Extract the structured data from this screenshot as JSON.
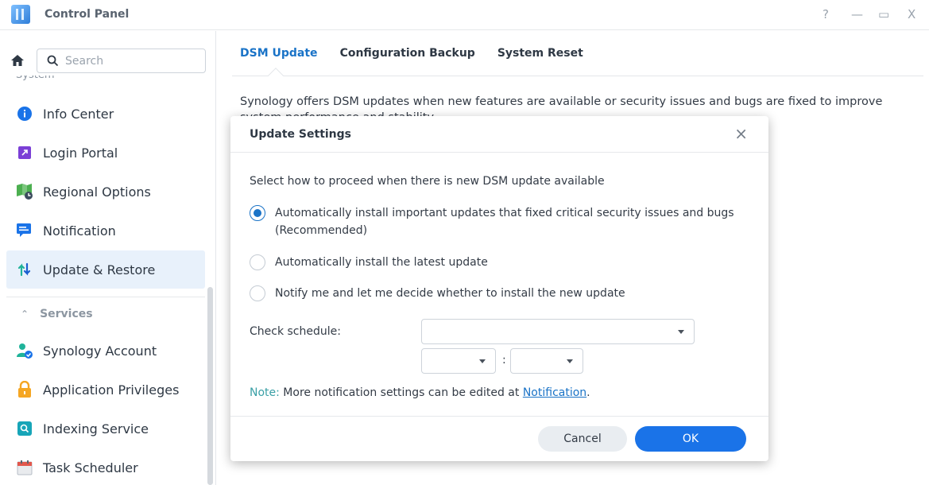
{
  "window": {
    "title": "Control Panel",
    "controls": {
      "help": "?",
      "minimize": "—",
      "maximize": "▭",
      "close": "X"
    }
  },
  "sidebar": {
    "search_placeholder": "Search",
    "cut_section": "System",
    "items": [
      {
        "label": "Info Center",
        "icon": "info-icon"
      },
      {
        "label": "Login Portal",
        "icon": "login-portal-icon"
      },
      {
        "label": "Regional Options",
        "icon": "regional-options-icon"
      },
      {
        "label": "Notification",
        "icon": "notification-icon"
      },
      {
        "label": "Update & Restore",
        "icon": "update-restore-icon",
        "active": true
      }
    ],
    "services_label": "Services",
    "services_items": [
      {
        "label": "Synology Account",
        "icon": "user-account-icon"
      },
      {
        "label": "Application Privileges",
        "icon": "lock-icon"
      },
      {
        "label": "Indexing Service",
        "icon": "indexing-icon"
      },
      {
        "label": "Task Scheduler",
        "icon": "calendar-icon"
      }
    ]
  },
  "main": {
    "tabs": [
      {
        "label": "DSM Update",
        "active": true
      },
      {
        "label": "Configuration Backup"
      },
      {
        "label": "System Reset"
      }
    ],
    "description": "Synology offers DSM updates when new features are available or security issues and bugs are fixed to improve system performance and stability."
  },
  "dialog": {
    "title": "Update Settings",
    "close": "×",
    "intro": "Select how to proceed when there is new DSM update available",
    "options": [
      {
        "label": "Automatically install important updates that fixed critical security issues and bugs (Recommended)",
        "checked": true
      },
      {
        "label": "Automatically install the latest update",
        "checked": false
      },
      {
        "label": "Notify me and let me decide whether to install the new update",
        "checked": false
      }
    ],
    "schedule_label": "Check schedule:",
    "schedule_value": "",
    "hour_value": "",
    "minute_value": "",
    "time_separator": ":",
    "note_label": "Note:",
    "note_text": " More notification settings can be edited at ",
    "note_link": "Notification",
    "note_end": ".",
    "cancel_label": "Cancel",
    "ok_label": "OK"
  },
  "colors": {
    "accent": "#1a73e8",
    "active_bg": "#e8f1fb",
    "note": "#3aa0a6"
  }
}
